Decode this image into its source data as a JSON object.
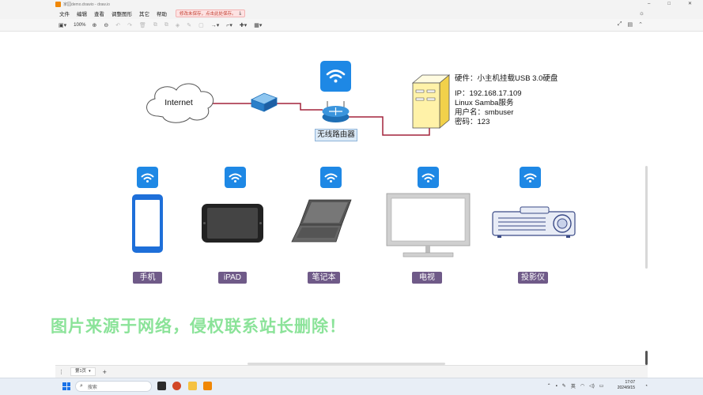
{
  "window": {
    "title": "家园demo.drawio - draw.io",
    "controls": [
      "–",
      "□",
      "✕"
    ]
  },
  "menu": {
    "items": [
      "文件",
      "编辑",
      "查看",
      "调整图形",
      "其它",
      "帮助"
    ],
    "warning": "修改未保存，点击此处保存。"
  },
  "toolbar": {
    "zoom": "100%"
  },
  "diagram": {
    "internet_label": "Internet",
    "router_label": "无线路由器",
    "server_info": {
      "hardware": "硬件：小主机挂载USB 3.0硬盘",
      "ip": "IP：192.168.17.109",
      "service": "Linux Samba服务",
      "user": "用户名：smbuser",
      "password": "密码：123"
    },
    "devices": [
      {
        "label": "手机"
      },
      {
        "label": "iPAD"
      },
      {
        "label": "笔记本"
      },
      {
        "label": "电视"
      },
      {
        "label": "投影仪"
      }
    ],
    "colors": {
      "wifi_blue": "#1e88e5",
      "label_purple": "#6f5a88",
      "server_yellow": "#fff2a8",
      "link_red": "#a3243b"
    }
  },
  "watermark": "图片来源于网络，侵权联系站长删除！",
  "pages": {
    "current_tab": "第1页"
  },
  "taskbar": {
    "search_placeholder": "搜索",
    "ime": "英",
    "time": "17:07",
    "date": "2024/9/15"
  }
}
